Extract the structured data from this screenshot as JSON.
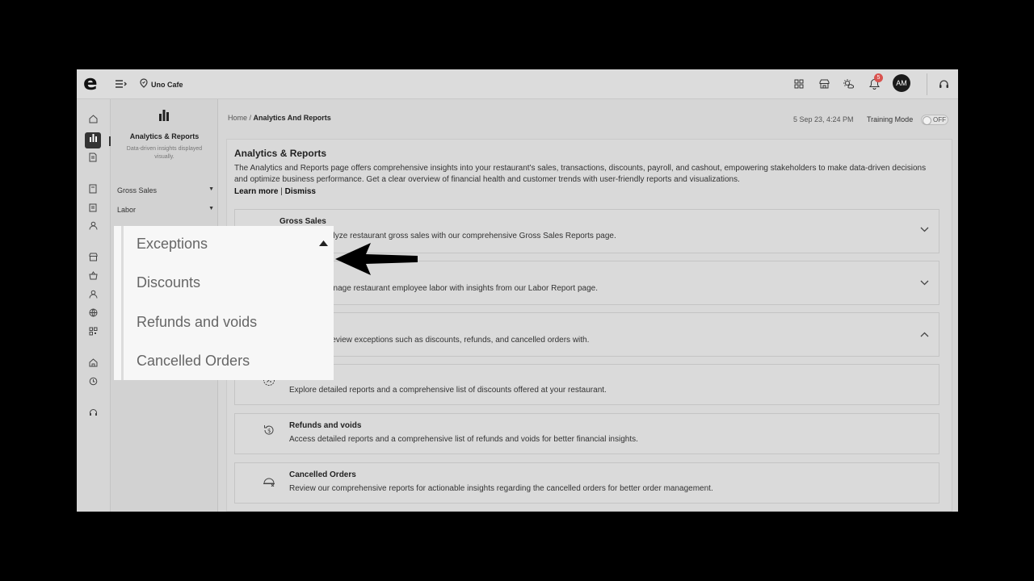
{
  "topbar": {
    "logo_letter": "e",
    "location": "Uno Cafe",
    "notification_count": "5",
    "avatar_initials": "AM"
  },
  "sidebar": {
    "header_title": "Analytics & Reports",
    "header_subtitle": "Data-driven insights displayed visually.",
    "items": [
      {
        "label": "Gross Sales"
      },
      {
        "label": "Labor"
      }
    ]
  },
  "header": {
    "breadcrumb_home": "Home",
    "breadcrumb_sep": " / ",
    "breadcrumb_current": "Analytics And Reports",
    "datetime": "5 Sep 23, 4:24 PM",
    "training_mode_label": "Training Mode",
    "training_mode_state": "OFF"
  },
  "main": {
    "title": "Analytics & Reports",
    "description": "The Analytics and Reports page offers comprehensive insights into your restaurant's sales, transactions, discounts, payroll, and cashout, empowering stakeholders to make data-driven decisions and optimize business performance. Get a clear overview of financial health and customer trends with user-friendly reports and visualizations.",
    "learn_more": "Learn more",
    "link_sep": " | ",
    "dismiss": "Dismiss",
    "sections": [
      {
        "title": "Gross Sales",
        "desc_visible": "alyze restaurant gross sales with our comprehensive Gross Sales Reports page."
      },
      {
        "desc_visible": "anage restaurant employee labor with insights from our Labor Report page."
      },
      {
        "desc_visible": "review exceptions such as discounts, refunds, and cancelled orders with."
      }
    ],
    "sub_reports": [
      {
        "title": "",
        "desc": "Explore detailed reports and a comprehensive list of discounts offered at your restaurant."
      },
      {
        "title": "Refunds and voids",
        "desc": "Access detailed reports and a comprehensive list of refunds and voids for better financial insights."
      },
      {
        "title": "Cancelled Orders",
        "desc": "Review our comprehensive reports for actionable insights regarding the cancelled orders for better order management."
      }
    ]
  },
  "zoom": {
    "items": [
      {
        "label": "Exceptions"
      },
      {
        "label": "Discounts"
      },
      {
        "label": "Refunds and voids"
      },
      {
        "label": "Cancelled Orders"
      }
    ]
  }
}
